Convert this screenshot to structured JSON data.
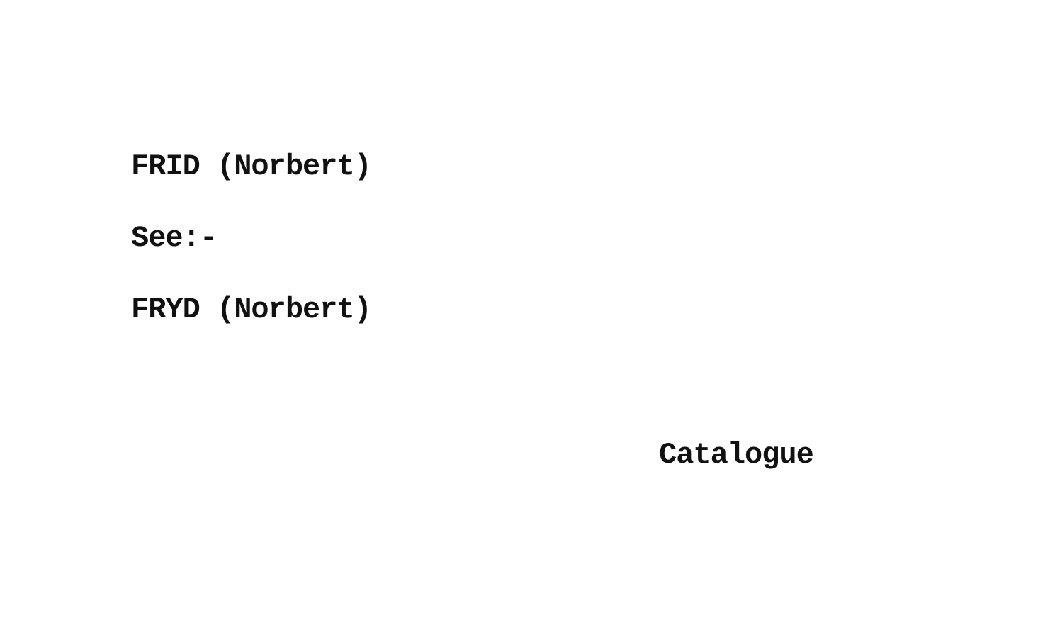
{
  "card": {
    "heading": "FRID (Norbert)",
    "see_label": "See:-",
    "reference": "FRYD (Norbert)",
    "footer_label": "Catalogue"
  }
}
